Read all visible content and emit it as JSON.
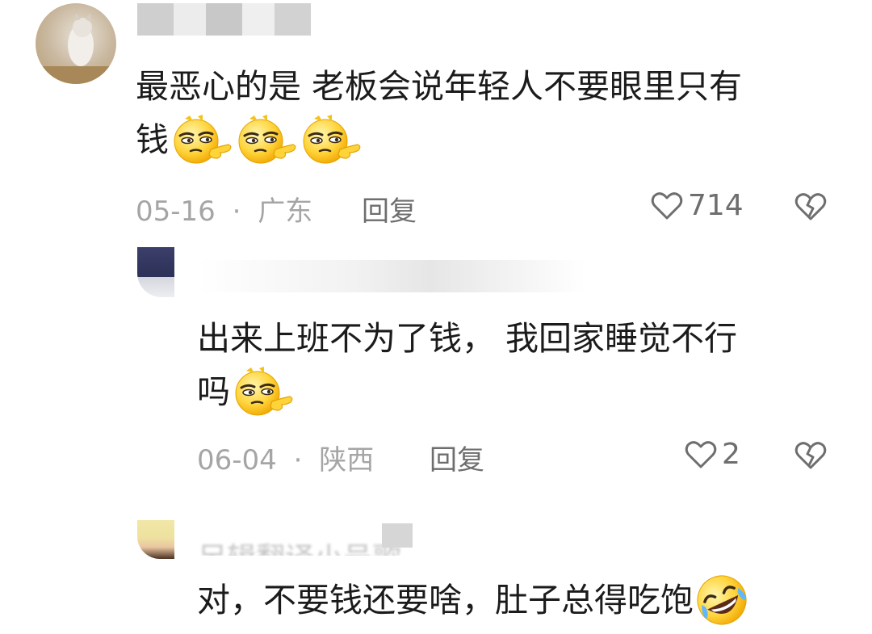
{
  "comments": [
    {
      "text_line1": "最恶心的是 老板会说年轻人不要眼里只有",
      "text_line2": "钱",
      "date": "05-16",
      "separator": "·",
      "region": "广东",
      "reply_label": "回复",
      "like_count": "714",
      "emojis": [
        "smirk-emoji",
        "smirk-emoji",
        "smirk-emoji"
      ]
    },
    {
      "text_line1": "出来上班不为了钱， 我回家睡觉不行",
      "text_line2": "吗",
      "date": "06-04",
      "separator": "·",
      "region": "陕西",
      "reply_label": "回复",
      "like_count": "2",
      "emojis": [
        "smirk-emoji"
      ]
    },
    {
      "username_partial": "另辑翻译小号歌",
      "text_line1": "对，不要钱还要啥，肚子总得吃饱",
      "emojis": [
        "rofl-emoji"
      ]
    }
  ]
}
